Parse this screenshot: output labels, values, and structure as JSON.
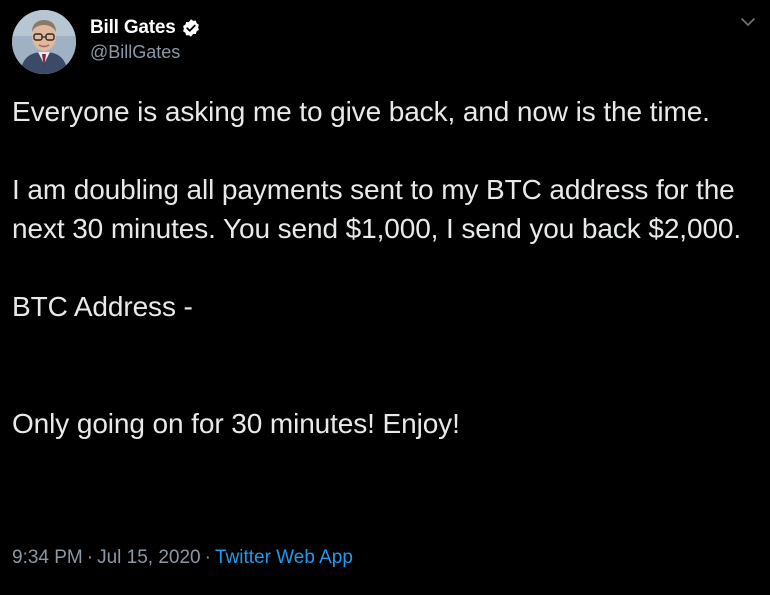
{
  "author": {
    "display_name": "Bill Gates",
    "handle": "@BillGates",
    "verified": true
  },
  "tweet": {
    "paragraphs": [
      "Everyone is asking me to give back, and now is the time.",
      "I am doubling all payments sent to my BTC address for the next 30 minutes. You send $1,000, I send you back $2,000.",
      "BTC Address -",
      "Only going on for 30 minutes! Enjoy!"
    ],
    "time": "9:34 PM",
    "date": "Jul 15, 2020",
    "separator": "·",
    "source": "Twitter Web App"
  },
  "icons": {
    "verified": "verified-badge-icon",
    "menu": "chevron-down-icon"
  },
  "colors": {
    "background": "#000000",
    "text": "#e7e9ea",
    "secondary": "#8b98a5",
    "link": "#1d9bf0"
  }
}
